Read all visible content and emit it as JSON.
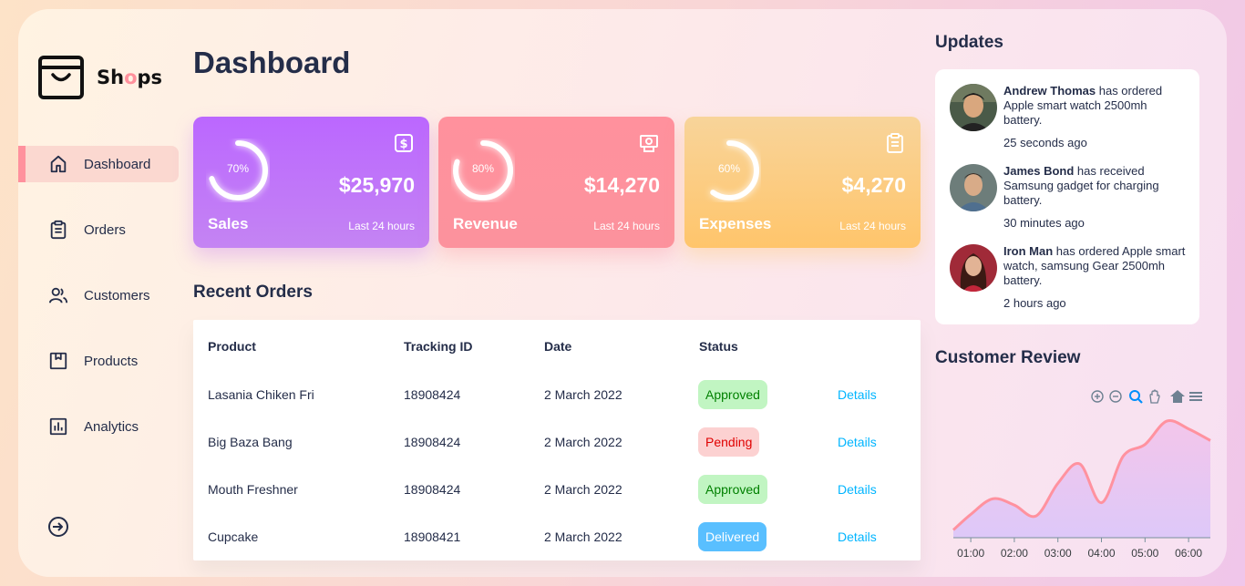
{
  "brand": {
    "prefix": "Sh",
    "accent": "o",
    "suffix": "ps",
    "accent_color": "#ff919d"
  },
  "sidebar": {
    "items": [
      {
        "label": "Dashboard",
        "icon": "home-icon",
        "active": true
      },
      {
        "label": "Orders",
        "icon": "clipboard-icon",
        "active": false
      },
      {
        "label": "Customers",
        "icon": "users-icon",
        "active": false
      },
      {
        "label": "Products",
        "icon": "package-icon",
        "active": false
      },
      {
        "label": "Analytics",
        "icon": "bar-chart-icon",
        "active": false
      }
    ],
    "logout_icon": "sign-out-icon"
  },
  "page_title": "Dashboard",
  "cards": [
    {
      "title": "Sales",
      "value": "$25,970",
      "percent_label": "70%",
      "percent": 70,
      "subtitle": "Last 24 hours",
      "icon": "dollar-icon",
      "color": "#bb67ff"
    },
    {
      "title": "Revenue",
      "value": "$14,270",
      "percent_label": "80%",
      "percent": 80,
      "subtitle": "Last 24 hours",
      "icon": "money-icon",
      "color": "#ff919d"
    },
    {
      "title": "Expenses",
      "value": "$4,270",
      "percent_label": "60%",
      "percent": 60,
      "subtitle": "Last 24 hours",
      "icon": "clipboard-icon",
      "color": "#ffc56b"
    }
  ],
  "recent_orders": {
    "title": "Recent Orders",
    "headers": [
      "Product",
      "Tracking ID",
      "Date",
      "Status"
    ],
    "rows": [
      {
        "product": "Lasania Chiken Fri",
        "tracking": "18908424",
        "date": "2 March 2022",
        "status": "Approved",
        "details": "Details"
      },
      {
        "product": "Big Baza Bang",
        "tracking": "18908424",
        "date": "2 March 2022",
        "status": "Pending",
        "details": "Details"
      },
      {
        "product": "Mouth Freshner",
        "tracking": "18908424",
        "date": "2 March 2022",
        "status": "Approved",
        "details": "Details"
      },
      {
        "product": "Cupcake",
        "tracking": "18908421",
        "date": "2 March 2022",
        "status": "Delivered",
        "details": "Details"
      }
    ],
    "status_colors": {
      "Approved": {
        "bg": "#c1f5c2",
        "fg": "#008000"
      },
      "Pending": {
        "bg": "#fcd1d1",
        "fg": "#e00000"
      },
      "Delivered": {
        "bg": "#59bfff",
        "fg": "#ffffff"
      }
    }
  },
  "updates": {
    "title": "Updates",
    "items": [
      {
        "name": "Andrew Thomas",
        "text": " has ordered Apple smart watch 2500mh battery.",
        "time": "25 seconds ago"
      },
      {
        "name": "James Bond",
        "text": " has received Samsung gadget for charging battery.",
        "time": "30 minutes ago"
      },
      {
        "name": "Iron Man",
        "text": " has ordered Apple smart watch, samsung Gear 2500mh battery.",
        "time": "2 hours ago"
      }
    ]
  },
  "customer_review": {
    "title": "Customer Review",
    "toolbar_icons": [
      "zoom-in-icon",
      "zoom-out-icon",
      "zoom-select-icon",
      "pan-hand-icon",
      "reset-home-icon",
      "menu-icon"
    ]
  },
  "chart_data": {
    "type": "area",
    "title": "Customer Review",
    "categories": [
      "01:00",
      "02:00",
      "03:00",
      "04:00",
      "05:00",
      "06:00"
    ],
    "x": [
      0.6,
      1.0,
      1.5,
      2.0,
      2.5,
      3.0,
      3.5,
      4.0,
      4.5,
      5.0,
      5.5,
      6.0,
      6.5
    ],
    "y": [
      10,
      30,
      50,
      42,
      28,
      70,
      95,
      45,
      105,
      120,
      150,
      140,
      125
    ],
    "ylim": [
      0,
      170
    ],
    "line_color": "#ff929f",
    "fill_color": "#e1cbf8",
    "grid": false,
    "show_y_axis": false
  }
}
